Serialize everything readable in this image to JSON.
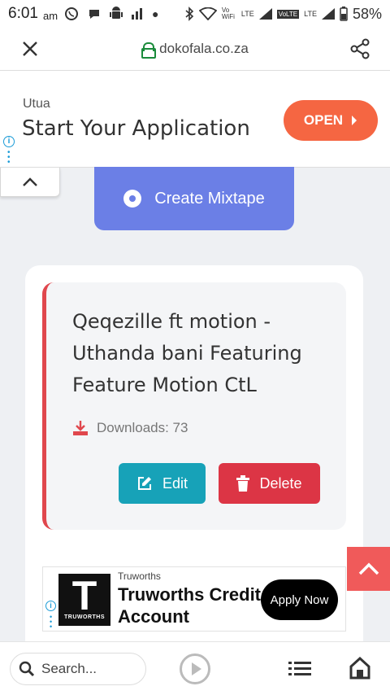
{
  "status_bar": {
    "time": "6:01",
    "ampm": "am",
    "battery": "58%",
    "net_labels": [
      "Vo WiFi",
      "LTE",
      "VoLTE",
      "LTE"
    ]
  },
  "browser": {
    "url": "dokofala.co.za"
  },
  "top_ad": {
    "brand": "Utua",
    "headline": "Start Your Application",
    "button": "OPEN"
  },
  "main": {
    "create_button": "Create Mixtape",
    "track": {
      "title": "Qeqezille ft motion - Uthanda bani Featuring Feature Motion CtL",
      "downloads_label": "Downloads: 73"
    },
    "edit_label": "Edit",
    "delete_label": "Delete"
  },
  "bottom_ad": {
    "brand": "Truworths",
    "logo_letter": "T",
    "logo_text": "TRUWORTHS",
    "headline": "Truworths Credit Account",
    "button": "Apply Now"
  },
  "bottom_nav": {
    "search_placeholder": "Search..."
  },
  "colors": {
    "accent_blue": "#6b7fe6",
    "edit_teal": "#17a2b8",
    "delete_red": "#dc3545",
    "ad_orange": "#f56642"
  }
}
